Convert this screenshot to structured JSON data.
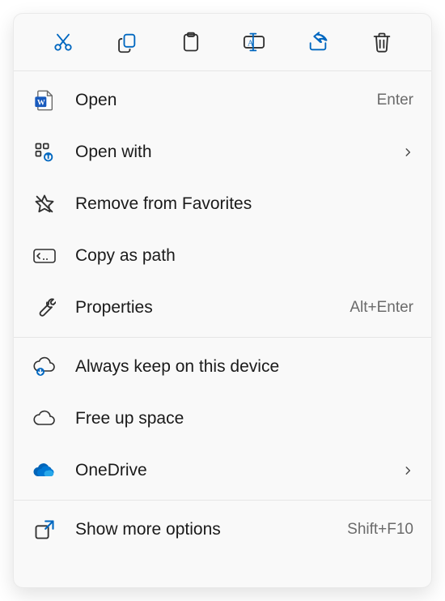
{
  "toolbar": {
    "cut_label": "Cut",
    "copy_label": "Copy",
    "paste_label": "Paste",
    "rename_label": "Rename",
    "share_label": "Share",
    "delete_label": "Delete"
  },
  "menu": {
    "open": {
      "label": "Open",
      "accel": "Enter"
    },
    "open_with": {
      "label": "Open with"
    },
    "remove_fav": {
      "label": "Remove from Favorites"
    },
    "copy_path": {
      "label": "Copy as path"
    },
    "properties": {
      "label": "Properties",
      "accel": "Alt+Enter"
    },
    "keep_device": {
      "label": "Always keep on this device"
    },
    "free_space": {
      "label": "Free up space"
    },
    "onedrive": {
      "label": "OneDrive"
    },
    "more": {
      "label": "Show more options",
      "accel": "Shift+F10"
    }
  }
}
